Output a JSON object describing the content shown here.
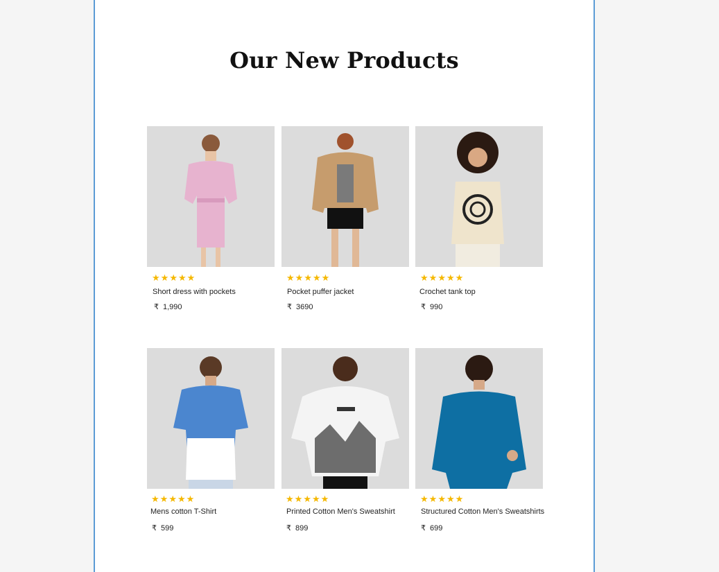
{
  "section": {
    "title": "Our New Products"
  },
  "colors": {
    "accent_border": "#5b9bd5",
    "star": "#f5b800",
    "image_bg": "#dcdcdc"
  },
  "products": [
    {
      "name": "Short dress with pockets",
      "currency": "₹",
      "price": "1,990",
      "rating": 5,
      "image": "pink-dress-photo"
    },
    {
      "name": "Pocket puffer jacket",
      "currency": "₹",
      "price": "3690",
      "rating": 5,
      "image": "puffer-jacket-photo"
    },
    {
      "name": "Crochet tank top",
      "currency": "₹",
      "price": "990",
      "rating": 5,
      "image": "crochet-top-photo"
    },
    {
      "name": "Mens cotton T-Shirt",
      "currency": "₹",
      "price": "599",
      "rating": 5,
      "image": "tshirt-photo"
    },
    {
      "name": "Printed Cotton Men's Sweatshirt",
      "currency": "₹",
      "price": "899",
      "rating": 5,
      "image": "printed-hoodie-photo"
    },
    {
      "name": "Structured Cotton Men's Sweatshirts",
      "currency": "₹",
      "price": "699",
      "rating": 5,
      "image": "blue-sweatshirt-photo"
    }
  ]
}
